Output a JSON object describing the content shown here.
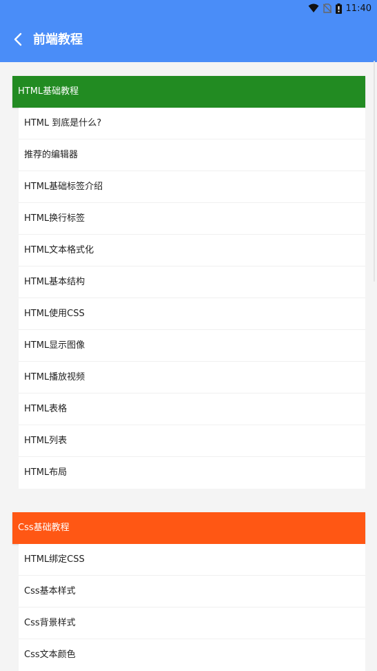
{
  "status_bar": {
    "time": "11:40",
    "icons": [
      "wifi-icon",
      "no-sim-icon",
      "battery-icon"
    ]
  },
  "app_bar": {
    "title": "前端教程",
    "back_icon": "chevron-left-icon",
    "background": "#4a8df8"
  },
  "sections": [
    {
      "title": "HTML基础教程",
      "color": "#228b22",
      "items": [
        "HTML 到底是什么?",
        "推荐的编辑器",
        "HTML基础标签介绍",
        "HTML换行标签",
        "HTML文本格式化",
        "HTML基本结构",
        "HTML使用CSS",
        "HTML显示图像",
        "HTML播放视频",
        "HTML表格",
        "HTML列表",
        "HTML布局"
      ]
    },
    {
      "title": "Css基础教程",
      "color": "#ff5714",
      "items": [
        "HTML绑定CSS",
        "Css基本样式",
        "Css背景样式",
        "Css文本颜色"
      ]
    }
  ]
}
